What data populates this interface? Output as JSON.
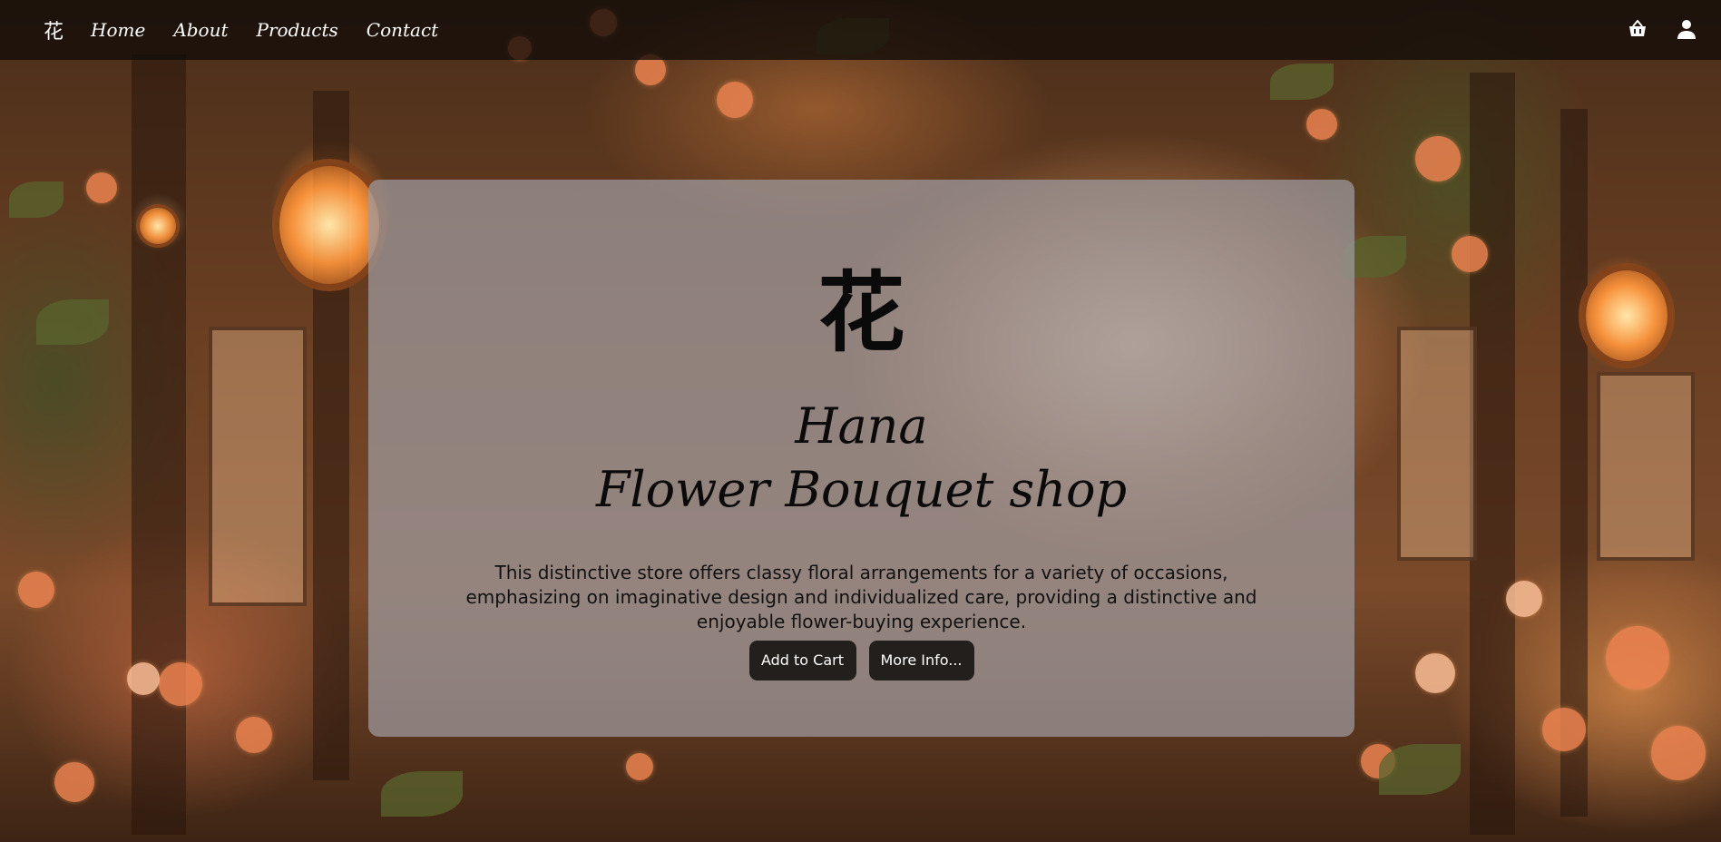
{
  "nav": {
    "logo": "花",
    "links": [
      {
        "label": "Home"
      },
      {
        "label": "About"
      },
      {
        "label": "Products"
      },
      {
        "label": "Contact"
      }
    ],
    "icons": [
      "basket-icon",
      "user-icon"
    ]
  },
  "hero": {
    "kanji": "花",
    "title_line1": "Hana",
    "title_line2": "Flower Bouquet shop",
    "description": "This distinctive store offers classy floral arrangements for a variety of occasions, emphasizing on imaginative design and individualized care, providing a distinctive and enjoyable flower-buying experience.",
    "buttons": {
      "add_to_cart": "Add to Cart",
      "more_info": "More Info..."
    }
  },
  "colors": {
    "navbar": "#120c08",
    "card": "#a09ba0",
    "button": "#231f1c"
  }
}
